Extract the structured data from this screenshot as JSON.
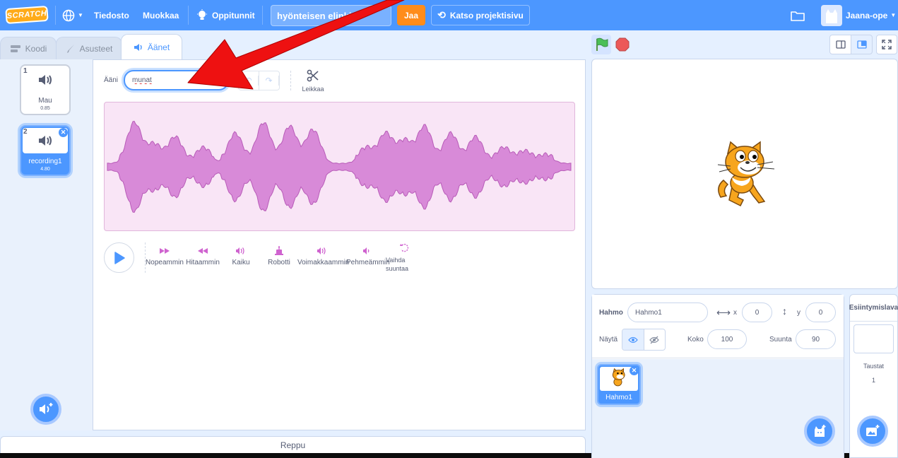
{
  "menubar": {
    "logo_text": "SCRATCH",
    "file_label": "Tiedosto",
    "edit_label": "Muokkaa",
    "tutorials_label": "Oppitunnit",
    "project_title": "hyönteisen elinkie",
    "share_label": "Jaa",
    "see_project_label": "Katso projektisivu",
    "username": "Jaana-ope"
  },
  "tabs": {
    "code": "Koodi",
    "costumes": "Asusteet",
    "sounds": "Äänet"
  },
  "sounds": [
    {
      "num": "1",
      "name": "Mau",
      "duration": "0.85"
    },
    {
      "num": "2",
      "name": "recording1",
      "duration": "4.80"
    }
  ],
  "editor": {
    "sound_label": "Ääni",
    "sound_name": "munat",
    "trim_label": "Leikkaa",
    "effects": [
      {
        "label": "Nopeammin",
        "glyph": "⏩"
      },
      {
        "label": "Hitaammin",
        "glyph": "⏪"
      },
      {
        "label": "Kaiku",
        "glyph": "🔊"
      },
      {
        "label": "Robotti",
        "glyph": "🤖"
      },
      {
        "label": "Voimakkaammin",
        "glyph": "🔊"
      },
      {
        "label": "Pehmeämmin",
        "glyph": "🔈"
      },
      {
        "label": "Vaihda suuntaa",
        "glyph": "↺"
      }
    ]
  },
  "backpack_label": "Reppu",
  "sprite_info": {
    "sprite_label": "Hahmo",
    "sprite_name": "Hahmo1",
    "x_label": "x",
    "x_value": "0",
    "y_label": "y",
    "y_value": "0",
    "show_label": "Näytä",
    "size_label": "Koko",
    "size_value": "100",
    "direction_label": "Suunta",
    "direction_value": "90"
  },
  "sprites": [
    {
      "name": "Hahmo1"
    }
  ],
  "stage_target": {
    "title": "Esiintymislava",
    "backdrops_label": "Taustat",
    "backdrops_count": "1"
  },
  "colors": {
    "accent": "#4c97ff",
    "sound_purple": "#cf63cf",
    "share_orange": "#ff8c1a",
    "annotation_arrow": "#ee1111"
  }
}
